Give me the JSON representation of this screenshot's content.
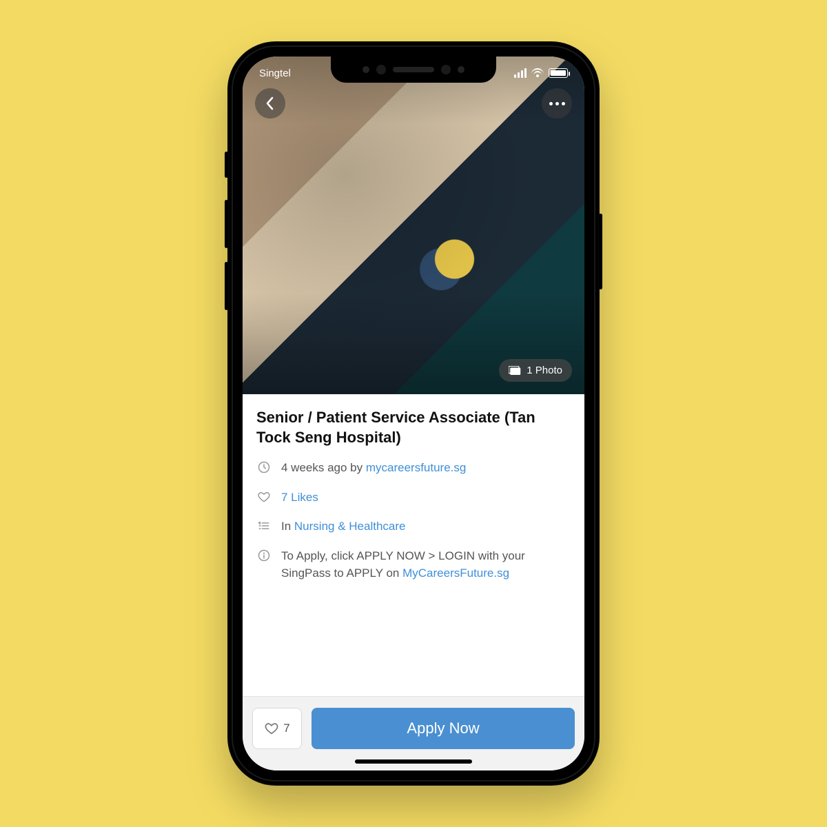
{
  "statusbar": {
    "carrier": "Singtel"
  },
  "hero": {
    "photo_badge": "1 Photo"
  },
  "job": {
    "title": "Senior / Patient Service Associate (Tan Tock Seng Hospital)",
    "posted_prefix": "4 weeks ago by ",
    "posted_source": "mycareersfuture.sg",
    "likes_text": "7 Likes",
    "category_prefix": "In ",
    "category_link": "Nursing & Healthcare",
    "info_prefix": "To Apply, click APPLY NOW > LOGIN with your SingPass to APPLY on ",
    "info_link": "MyCareersFuture.sg"
  },
  "bottom": {
    "like_count": "7",
    "apply_label": "Apply Now"
  }
}
